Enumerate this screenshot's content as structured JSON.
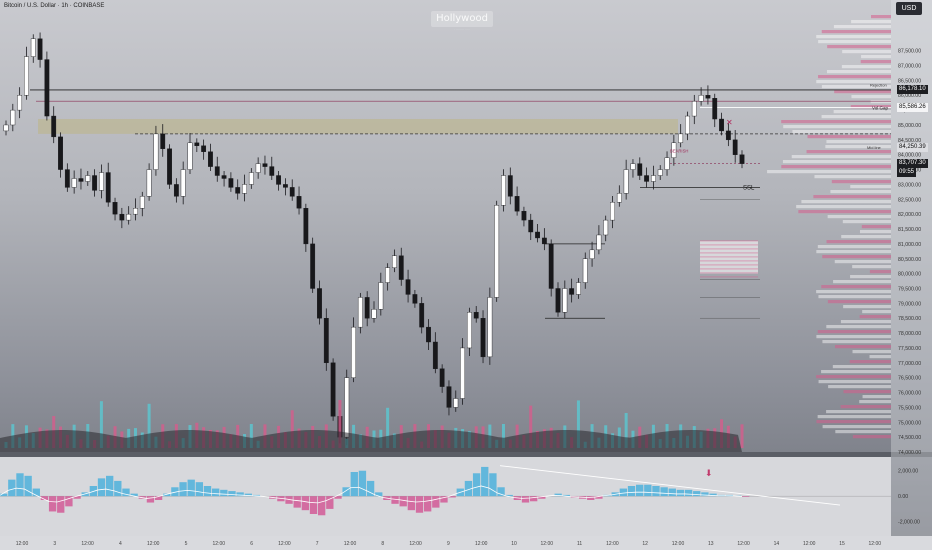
{
  "header": {
    "symbol": "Bitcoin / U.S. Dollar · 1h · COINBASE",
    "watermark": "Hollywood",
    "watermark_sub": "· ··· ····· ·····",
    "currency": "USD"
  },
  "price_tags": [
    {
      "label": "86,178.10",
      "y": 86178,
      "bg": "#1d1e22"
    },
    {
      "label": "85,586.26",
      "y": 85586,
      "bg": "#f4f4f6",
      "fg": "#111"
    },
    {
      "label": "84,250.39",
      "y": 84250,
      "bg": "#dcdde1",
      "fg": "#111"
    },
    {
      "label": "83,707.30",
      "y": 83707,
      "bg": "#1d1e22",
      "sub": "09:55"
    }
  ],
  "chart_labels": {
    "vol_gap": "Vol Gap",
    "ssl": "SSL",
    "bearish": "BEARISH",
    "rejection": "Rejection",
    "midline": "Mid line"
  },
  "chart_data": [
    {
      "type": "candlestick",
      "title": "",
      "ylim": [
        74000,
        88800
      ],
      "y_ticks": [
        "87,500.00",
        "87,000.00",
        "86,500.00",
        "86,000.00",
        "85,500.00",
        "85,000.00",
        "84,500.00",
        "84,000.00",
        "83,500.00",
        "83,000.00",
        "82,500.00",
        "82,000.00",
        "81,500.00",
        "81,000.00",
        "80,500.00",
        "80,000.00",
        "79,500.00",
        "79,000.00",
        "78,500.00",
        "78,000.00",
        "77,500.00",
        "77,000.00",
        "76,500.00",
        "76,000.00",
        "75,500.00",
        "75,000.00",
        "74,500.00",
        "74,000.00"
      ],
      "x_ticks": [
        "12:00",
        "3",
        "12:00",
        "4",
        "12:00",
        "5",
        "12:00",
        "6",
        "12:00",
        "7",
        "12:00",
        "8",
        "12:00",
        "9",
        "12:00",
        "10",
        "12:00",
        "11",
        "12:00",
        "12",
        "12:00",
        "13",
        "12:00",
        "14",
        "12:00",
        "15",
        "12:00"
      ],
      "series": [
        {
          "values": [
            85000,
            85500,
            86000,
            87300,
            87900,
            87200,
            85300,
            84600,
            83500,
            82900,
            83200,
            83100,
            83300,
            82800,
            83400,
            82400,
            82000,
            81800,
            82000,
            82200,
            82600,
            83500,
            84700,
            84200,
            83000,
            82600,
            83500,
            84400,
            84300,
            84100,
            83600,
            83300,
            83200,
            82900,
            82700,
            83000,
            83400,
            83700,
            83600,
            83300,
            83000,
            82900,
            82600,
            82200,
            81000,
            79500,
            78500,
            77000,
            75200,
            74500,
            76500,
            78200,
            79200,
            78500,
            78800,
            79700,
            80200,
            80600,
            79800,
            79300,
            79000,
            78200,
            77700,
            76800,
            76200,
            75500,
            75800,
            77500,
            78700,
            78500,
            77200,
            79200,
            82300,
            83300,
            82600,
            82100,
            81800,
            81400,
            81200,
            81000,
            79500,
            78700,
            79500,
            79300,
            79700,
            80500,
            80800,
            81300,
            81800,
            82400,
            82700,
            83500,
            83700,
            83300,
            83100,
            83300,
            83500,
            83900,
            84400,
            84700,
            85300,
            85800,
            86000,
            85900,
            85200,
            84800,
            84500,
            84000,
            83700
          ]
        }
      ],
      "levels": [
        86178,
        85586,
        84250,
        83707,
        82900
      ]
    },
    {
      "type": "bar",
      "title": "",
      "ylim": [
        -2500,
        3000
      ],
      "y_ticks": [
        "2,000.00",
        "0.00",
        "-2,000.00"
      ],
      "series": [
        {
          "values": [
            200,
            1300,
            1800,
            1600,
            600,
            -300,
            -1200,
            -1300,
            -800,
            -200,
            300,
            800,
            1400,
            1600,
            1200,
            600,
            200,
            -200,
            -500,
            -300,
            200,
            700,
            1100,
            1300,
            1100,
            800,
            600,
            500,
            400,
            300,
            200,
            100,
            0,
            -200,
            -400,
            -600,
            -900,
            -1100,
            -1400,
            -1500,
            -1000,
            -200,
            700,
            1900,
            2000,
            1200,
            300,
            -300,
            -600,
            -800,
            -1100,
            -1300,
            -1200,
            -900,
            -500,
            -100,
            600,
            1200,
            1800,
            2300,
            1800,
            700,
            100,
            -300,
            -500,
            -400,
            -200,
            0,
            200,
            100,
            -100,
            -200,
            -300,
            -200,
            100,
            300,
            600,
            800,
            900,
            900,
            800,
            700,
            600,
            500,
            500,
            400,
            300,
            200,
            100,
            100,
            50,
            -50
          ]
        }
      ]
    }
  ]
}
